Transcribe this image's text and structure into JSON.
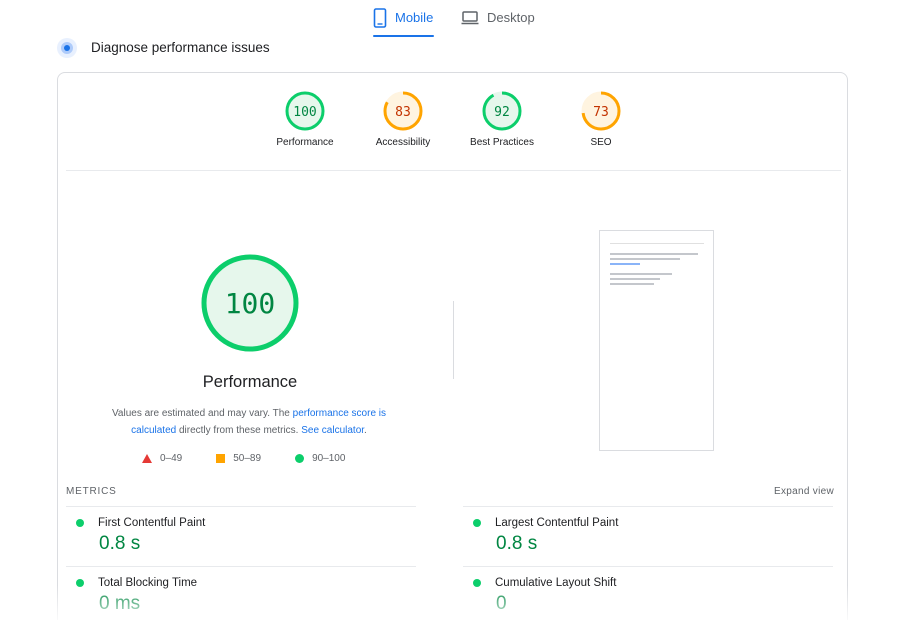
{
  "tabs": [
    {
      "label": "Mobile",
      "active": true,
      "icon": "phone-icon"
    },
    {
      "label": "Desktop",
      "active": false,
      "icon": "laptop-icon"
    }
  ],
  "header": {
    "title": "Diagnose performance issues"
  },
  "colors": {
    "good": "#0cce6b",
    "average": "#ffa400",
    "fail": "#e53935",
    "link": "#1a73e8",
    "value_good": "#018642"
  },
  "gauges": [
    {
      "label": "Performance",
      "score": "100",
      "score_fraction": 1.0,
      "status": "good"
    },
    {
      "label": "Accessibility",
      "score": "83",
      "score_fraction": 0.83,
      "status": "average"
    },
    {
      "label": "Best Practices",
      "score": "92",
      "score_fraction": 0.92,
      "status": "good"
    },
    {
      "label": "SEO",
      "score": "73",
      "score_fraction": 0.73,
      "status": "average"
    }
  ],
  "performance": {
    "score": "100",
    "title": "Performance",
    "desc_part1": "Values are estimated and may vary. The ",
    "desc_link1": "performance score is calculated",
    "desc_part2": " directly from these metrics. ",
    "desc_link2": "See calculator",
    "desc_part3": "."
  },
  "legend": [
    {
      "range": "0–49",
      "shape": "triangle"
    },
    {
      "range": "50–89",
      "shape": "square"
    },
    {
      "range": "90–100",
      "shape": "circle"
    }
  ],
  "metrics": {
    "title": "METRICS",
    "expand_label": "Expand view",
    "items": [
      {
        "name": "First Contentful Paint",
        "value": "0.8 s"
      },
      {
        "name": "Largest Contentful Paint",
        "value": "0.8 s"
      },
      {
        "name": "Total Blocking Time",
        "value": "0 ms"
      },
      {
        "name": "Cumulative Layout Shift",
        "value": "0"
      }
    ]
  }
}
